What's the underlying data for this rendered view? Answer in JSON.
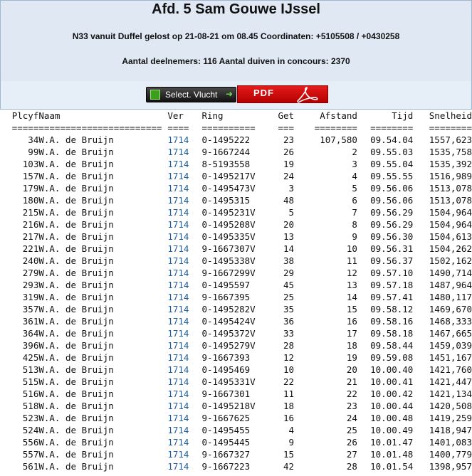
{
  "header": {
    "title": "Afd. 5 Sam Gouwe IJssel",
    "race_line": "N33 vanuit Duffel gelost op 21-08-21 om 08.45 Coordinaten: +5105508 / +0430258",
    "participants_line": "Aantal deelnemers: 116 Aantal duiven in concours: 2370"
  },
  "toolbar": {
    "select_label": "Select. Vlucht",
    "pdf_label": "PDF"
  },
  "table": {
    "headers": [
      "Plcyf",
      "Naam",
      "Ver",
      "Ring",
      "Get",
      "Afstand",
      "Tijd",
      "Snelheid"
    ],
    "underlines": [
      "=====",
      "=======================",
      "====",
      "==========",
      "===",
      "========",
      "========",
      "========"
    ],
    "rows": [
      [
        "34",
        "W.A. de Bruijn",
        "1714",
        "0-1495222",
        "23",
        "107,580",
        "09.54.04",
        "1557,623"
      ],
      [
        "99",
        "W.A. de Bruijn",
        "1714",
        "9-1667244",
        "26",
        "2",
        "09.55.03",
        "1535,758"
      ],
      [
        "103",
        "W.A. de Bruijn",
        "1714",
        "8-5193558",
        "19",
        "3",
        "09.55.04",
        "1535,392"
      ],
      [
        "157",
        "W.A. de Bruijn",
        "1714",
        "0-1495217V",
        "24",
        "4",
        "09.55.55",
        "1516,989"
      ],
      [
        "179",
        "W.A. de Bruijn",
        "1714",
        "0-1495473V",
        "3",
        "5",
        "09.56.06",
        "1513,078"
      ],
      [
        "180",
        "W.A. de Bruijn",
        "1714",
        "0-1495315",
        "48",
        "6",
        "09.56.06",
        "1513,078"
      ],
      [
        "215",
        "W.A. de Bruijn",
        "1714",
        "0-1495231V",
        "5",
        "7",
        "09.56.29",
        "1504,964"
      ],
      [
        "216",
        "W.A. de Bruijn",
        "1714",
        "0-1495208V",
        "20",
        "8",
        "09.56.29",
        "1504,964"
      ],
      [
        "217",
        "W.A. de Bruijn",
        "1714",
        "0-1495335V",
        "13",
        "9",
        "09.56.30",
        "1504,613"
      ],
      [
        "221",
        "W.A. de Bruijn",
        "1714",
        "9-1667307V",
        "14",
        "10",
        "09.56.31",
        "1504,262"
      ],
      [
        "240",
        "W.A. de Bruijn",
        "1714",
        "0-1495338V",
        "38",
        "11",
        "09.56.37",
        "1502,162"
      ],
      [
        "279",
        "W.A. de Bruijn",
        "1714",
        "9-1667299V",
        "29",
        "12",
        "09.57.10",
        "1490,714"
      ],
      [
        "293",
        "W.A. de Bruijn",
        "1714",
        "0-1495597",
        "45",
        "13",
        "09.57.18",
        "1487,964"
      ],
      [
        "319",
        "W.A. de Bruijn",
        "1714",
        "9-1667395",
        "25",
        "14",
        "09.57.41",
        "1480,117"
      ],
      [
        "357",
        "W.A. de Bruijn",
        "1714",
        "0-1495282V",
        "35",
        "15",
        "09.58.12",
        "1469,670"
      ],
      [
        "361",
        "W.A. de Bruijn",
        "1714",
        "0-1495424V",
        "36",
        "16",
        "09.58.16",
        "1468,333"
      ],
      [
        "364",
        "W.A. de Bruijn",
        "1714",
        "0-1495372V",
        "33",
        "17",
        "09.58.18",
        "1467,665"
      ],
      [
        "396",
        "W.A. de Bruijn",
        "1714",
        "0-1495279V",
        "28",
        "18",
        "09.58.44",
        "1459,039"
      ],
      [
        "425",
        "W.A. de Bruijn",
        "1714",
        "9-1667393",
        "12",
        "19",
        "09.59.08",
        "1451,167"
      ],
      [
        "513",
        "W.A. de Bruijn",
        "1714",
        "0-1495469",
        "10",
        "20",
        "10.00.40",
        "1421,760"
      ],
      [
        "515",
        "W.A. de Bruijn",
        "1714",
        "0-1495331V",
        "22",
        "21",
        "10.00.41",
        "1421,447"
      ],
      [
        "516",
        "W.A. de Bruijn",
        "1714",
        "9-1667301",
        "11",
        "22",
        "10.00.42",
        "1421,134"
      ],
      [
        "518",
        "W.A. de Bruijn",
        "1714",
        "0-1495218V",
        "18",
        "23",
        "10.00.44",
        "1420,508"
      ],
      [
        "523",
        "W.A. de Bruijn",
        "1714",
        "9-1667625",
        "16",
        "24",
        "10.00.48",
        "1419,259"
      ],
      [
        "524",
        "W.A. de Bruijn",
        "1714",
        "0-1495455",
        "4",
        "25",
        "10.00.49",
        "1418,947"
      ],
      [
        "556",
        "W.A. de Bruijn",
        "1714",
        "0-1495445",
        "9",
        "26",
        "10.01.47",
        "1401,083"
      ],
      [
        "557",
        "W.A. de Bruijn",
        "1714",
        "9-1667327",
        "15",
        "27",
        "10.01.48",
        "1400,779"
      ],
      [
        "561",
        "W.A. de Bruijn",
        "1714",
        "9-1667223",
        "42",
        "28",
        "10.01.54",
        "1398,957"
      ]
    ]
  },
  "colors": {
    "header_bg": "#dfe8f3",
    "border": "#9fb6cf",
    "link": "#1f5fa0",
    "pdf_red": "#d10000",
    "select_green": "#3aa01c"
  },
  "icons": {
    "select_button": "download-icon",
    "select_arrow": "arrow-right-icon",
    "pdf_button": "acrobat-icon"
  }
}
